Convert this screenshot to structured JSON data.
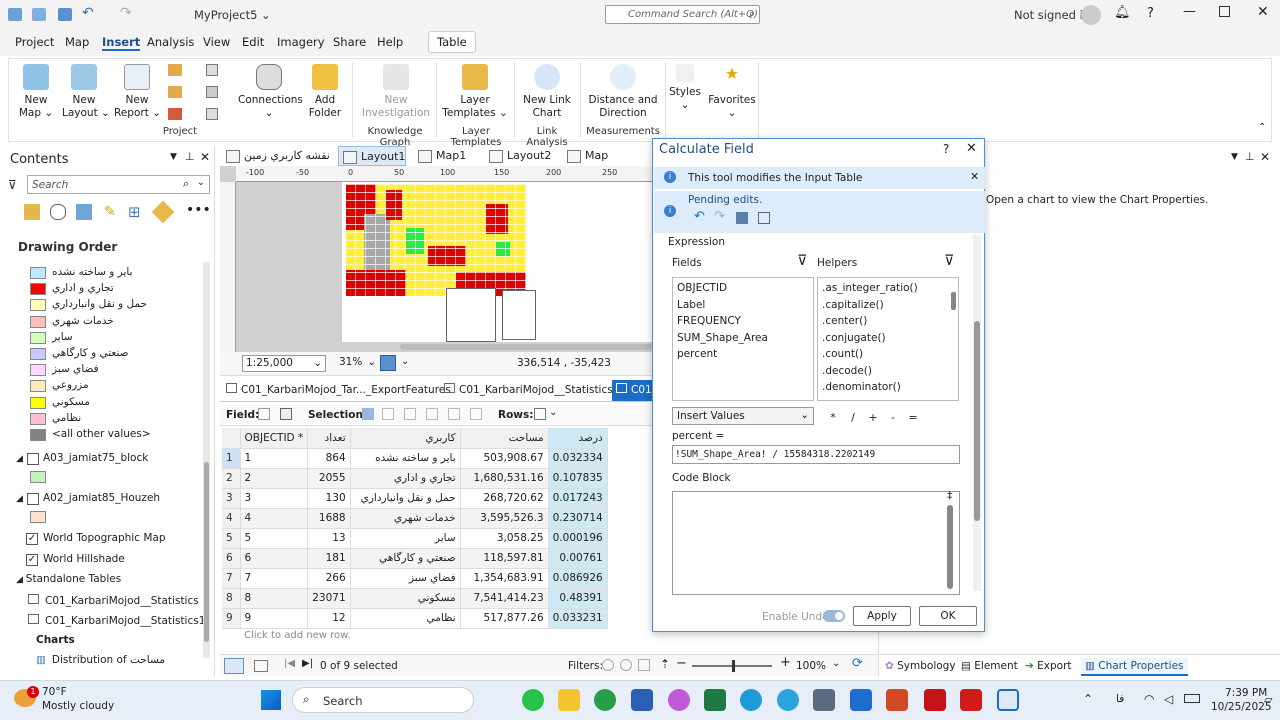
{
  "titlebar": {
    "project": "MyProject5 ⌄",
    "search_placeholder": "Command Search (Alt+Q)",
    "signin": "Not signed in"
  },
  "menu": [
    "Project",
    "Map",
    "Insert",
    "Analysis",
    "View",
    "Edit",
    "Imagery",
    "Share",
    "Help",
    "Table"
  ],
  "ribbon": {
    "buttons": [
      {
        "label": "New\nMap ⌄"
      },
      {
        "label": "New\nLayout ⌄"
      },
      {
        "label": "New\nReport ⌄"
      },
      {
        "label": "Connections\n⌄"
      },
      {
        "label": "Add\nFolder"
      },
      {
        "label": "New\nInvestigation"
      },
      {
        "label": "Layer\nTemplates ⌄"
      },
      {
        "label": "New Link\nChart"
      },
      {
        "label": "Distance and\nDirection"
      },
      {
        "label": "Styles\n⌄"
      },
      {
        "label": "Favorites\n⌄"
      }
    ],
    "groups": [
      "Project",
      "Knowledge Graph",
      "Layer Templates",
      "Link Analysis",
      "Measurements"
    ]
  },
  "contents": {
    "title": "Contents",
    "search_placeholder": "Search",
    "drawing_order": "Drawing Order",
    "legend": [
      {
        "label": "بایر و ساخته نشده",
        "color": "#bee8ff"
      },
      {
        "label": "تجاري و اداري",
        "color": "#ff0000"
      },
      {
        "label": "حمل و نقل وانبارداري",
        "color": "#ffffbe"
      },
      {
        "label": "خدمات شهري",
        "color": "#ffbebe"
      },
      {
        "label": "سایر",
        "color": "#d3ffbe"
      },
      {
        "label": "صنعتي و كارگاهي",
        "color": "#c8c8ff"
      },
      {
        "label": "فضاي سبز",
        "color": "#ffd6ff"
      },
      {
        "label": "مزروعي",
        "color": "#ffebbe"
      },
      {
        "label": "مسكوني",
        "color": "#ffff00"
      },
      {
        "label": "نظامي",
        "color": "#ffbed2"
      },
      {
        "label": "<all other values>",
        "color": "#828282"
      }
    ],
    "layers": [
      "A03_jamiat75_block",
      "A02_jamiat85_Houzeh",
      "World Topographic Map",
      "World Hillshade"
    ],
    "standalone": "Standalone Tables",
    "tables": [
      "C01_KarbariMojod__Statistics",
      "C01_KarbariMojod__Statistics1"
    ],
    "charts": "Charts",
    "chart_item": "Distribution of مساحت"
  },
  "view_tabs": [
    "نقشه كاربري زمين",
    "Layout1",
    "Map1",
    "Layout2",
    "Map"
  ],
  "map_status": {
    "scale": "1:25,000",
    "zoom": "31%",
    "coords": "336,514 , -35,423"
  },
  "table_tabs": [
    "C01_KarbariMojod_Tar..._ExportFeatures",
    "C01_KarbariMojod__Statistics",
    "C01_"
  ],
  "table_toolbar": {
    "field": "Field:",
    "selection": "Selection:",
    "rows": "Rows:"
  },
  "table": {
    "headers": [
      "OBJECTID *",
      "تعداد",
      "كاربري",
      "مساحت",
      "درصد"
    ],
    "rows": [
      [
        "1",
        "864",
        "بایر و ساخته نشده",
        "503,908.67",
        "0.032334"
      ],
      [
        "2",
        "2055",
        "تجاري و اداري",
        "1,680,531.16",
        "0.107835"
      ],
      [
        "3",
        "130",
        "حمل و نقل وانبارداري",
        "268,720.62",
        "0.017243"
      ],
      [
        "4",
        "1688",
        "خدمات شهري",
        "3,595,526.3",
        "0.230714"
      ],
      [
        "5",
        "13",
        "سایر",
        "3,058.25",
        "0.000196"
      ],
      [
        "6",
        "181",
        "صنعتي و كارگاهي",
        "118,597.81",
        "0.00761"
      ],
      [
        "7",
        "266",
        "فضاي سبز",
        "1,354,683.91",
        "0.086926"
      ],
      [
        "8",
        "23071",
        "مسكوني",
        "7,541,414.23",
        "0.48391"
      ],
      [
        "9",
        "12",
        "نظامي",
        "517,877.26",
        "0.033231"
      ]
    ],
    "add_row": "Click to add new row.",
    "status": "0 of 9 selected",
    "filters": "Filters:",
    "zoom": "100%"
  },
  "dialog": {
    "title": "Calculate Field",
    "info": "This tool modifies the Input Table",
    "pending": "Pending edits.",
    "expression": "Expression",
    "fields_label": "Fields",
    "helpers_label": "Helpers",
    "fields": [
      "OBJECTID",
      "Label",
      "FREQUENCY",
      "SUM_Shape_Area",
      "percent"
    ],
    "helpers": [
      ".as_integer_ratio()",
      ".capitalize()",
      ".center()",
      ".conjugate()",
      ".count()",
      ".decode()",
      ".denominator()"
    ],
    "insert_values": "Insert Values",
    "ops": [
      "*",
      "/",
      "+",
      "-",
      "="
    ],
    "target": "percent =",
    "expr": "!SUM_Shape_Area! / 15584318.2202149",
    "code_block": "Code Block",
    "enable_undo": "Enable Undo",
    "apply": "Apply",
    "ok": "OK"
  },
  "right_panel": {
    "message": "Open a chart to view the Chart Properties.",
    "tabs": [
      "Symbology",
      "Element",
      "Export",
      "Chart Properties"
    ]
  },
  "taskbar": {
    "temp": "70°F",
    "weather": "Mostly cloudy",
    "search": "Search",
    "time": "7:39 PM",
    "date": "10/25/2025",
    "lang": "فا"
  }
}
